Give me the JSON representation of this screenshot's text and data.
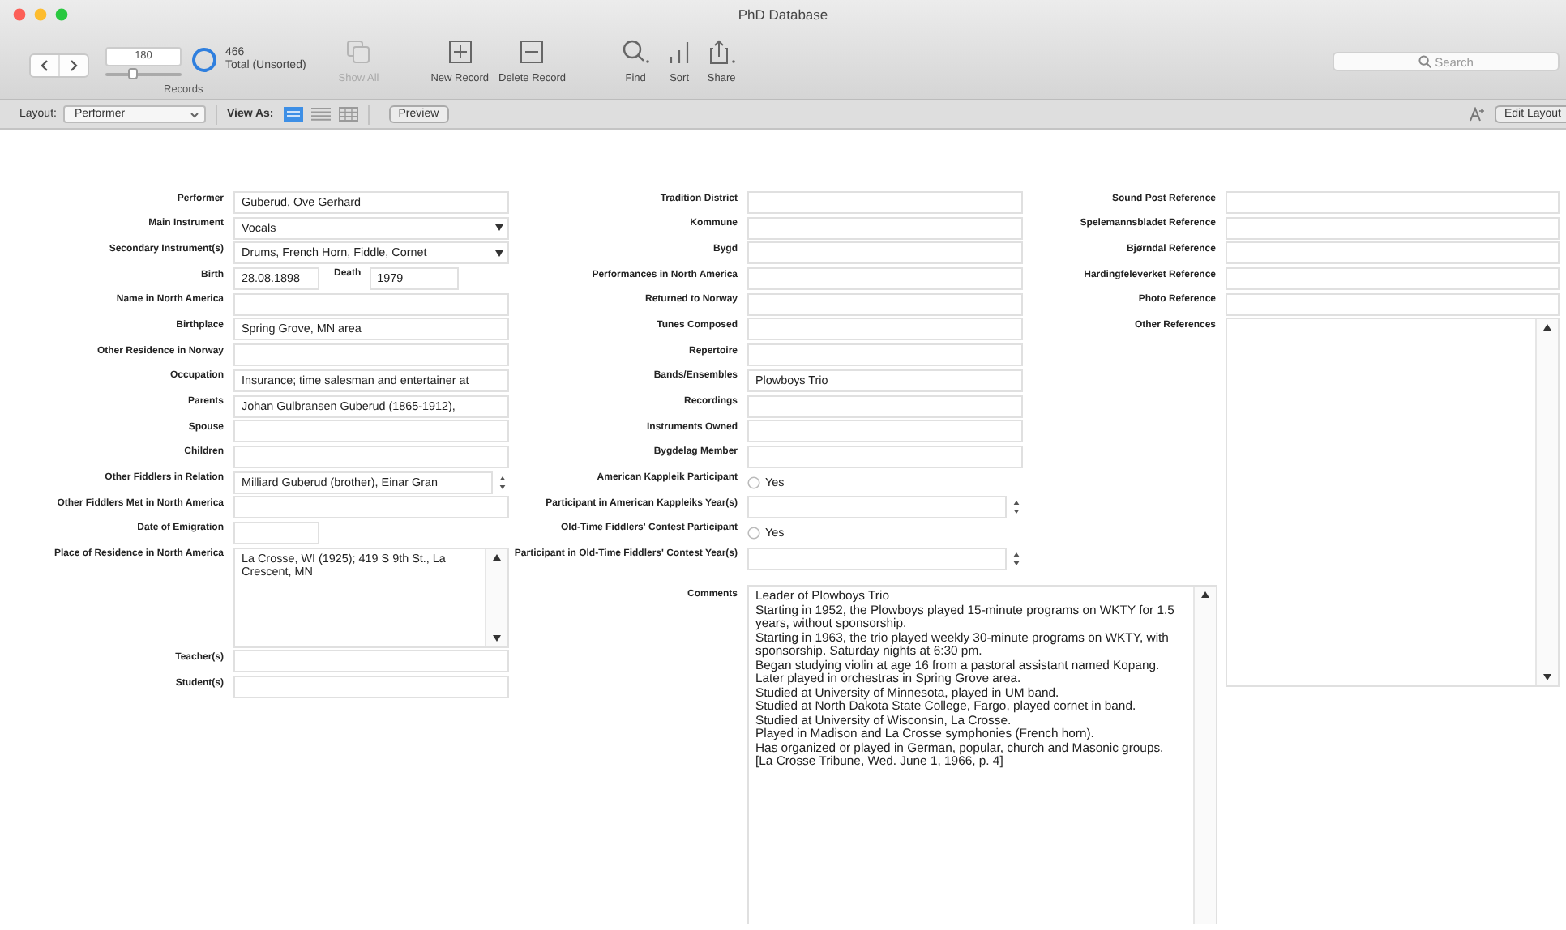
{
  "window": {
    "title": "PhD Database"
  },
  "toolbar": {
    "records": {
      "current": "180",
      "level": 0.39,
      "count": "466",
      "sort_status": "Total (Unsorted)",
      "label": "Records"
    },
    "buttons": [
      {
        "kind": "show-all",
        "label": "Show All",
        "disabled": true
      },
      {
        "kind": "new",
        "label": "New Record",
        "disabled": false
      },
      {
        "kind": "delete",
        "label": "Delete Record",
        "disabled": false
      },
      {
        "kind": "find",
        "label": "Find",
        "disabled": false
      },
      {
        "kind": "sort",
        "label": "Sort",
        "disabled": false
      },
      {
        "kind": "share",
        "label": "Share",
        "disabled": false
      }
    ],
    "search": {
      "placeholder": "Search"
    }
  },
  "layout_bar": {
    "layout_label": "Layout:",
    "layout": "Performer",
    "view_as_label": "View As:",
    "views": [
      {
        "kind": "form",
        "selected": true
      },
      {
        "kind": "list",
        "selected": false
      },
      {
        "kind": "table",
        "selected": false
      }
    ],
    "preview": "Preview",
    "edit_layout": "Edit Layout"
  },
  "form": {
    "columns": [
      {
        "fields": [
          {
            "kind": "text",
            "label": "Performer",
            "value": "Guberud, Ove Gerhard"
          },
          {
            "kind": "dropdown",
            "label": "Main Instrument",
            "value": "Vocals"
          },
          {
            "kind": "dropdown",
            "label": "Secondary Instrument(s)",
            "value": "Drums, French Horn, Fiddle, Cornet"
          },
          {
            "kind": "pair",
            "label": "Birth",
            "value": "28.08.1898",
            "second_label": "Death",
            "second_value": "1979"
          },
          {
            "kind": "text",
            "label": "Name in North America"
          },
          {
            "kind": "text",
            "label": "Birthplace",
            "value": "Spring Grove, MN area"
          },
          {
            "kind": "text",
            "label": "Other Residence in Norway"
          },
          {
            "kind": "text",
            "label": "Occupation",
            "value": "Insurance; time salesman and entertainer at"
          },
          {
            "kind": "text",
            "label": "Parents",
            "value": "Johan Gulbransen Guberud (1865-1912),"
          },
          {
            "kind": "text",
            "label": "Spouse"
          },
          {
            "kind": "text",
            "label": "Children"
          },
          {
            "kind": "stepper",
            "label": "Other Fiddlers in Relation",
            "value": "Milliard Guberud (brother), Einar Gran"
          },
          {
            "kind": "text",
            "label": "Other Fiddlers Met in North America"
          },
          {
            "kind": "short",
            "label": "Date of Emigration"
          },
          {
            "kind": "textarea",
            "label": "Place of Residence in North America",
            "lines": [
              "La Crosse, WI (1925); 419 S 9th St., La Crescent, MN"
            ]
          },
          {
            "kind": "text",
            "label": "Teacher(s)"
          },
          {
            "kind": "text",
            "label": "Student(s)"
          }
        ]
      },
      {
        "fields": [
          {
            "kind": "text",
            "label": "Tradition District"
          },
          {
            "kind": "text",
            "label": "Kommune"
          },
          {
            "kind": "text",
            "label": "Bygd"
          },
          {
            "kind": "text",
            "label": "Performances in North America"
          },
          {
            "kind": "text",
            "label": "Returned to Norway"
          },
          {
            "kind": "text",
            "label": "Tunes Composed"
          },
          {
            "kind": "text",
            "label": "Repertoire"
          },
          {
            "kind": "text",
            "label": "Bands/Ensembles",
            "value": "Plowboys Trio"
          },
          {
            "kind": "text",
            "label": "Recordings"
          },
          {
            "kind": "text",
            "label": "Instruments Owned"
          },
          {
            "kind": "text",
            "label": "Bygdelag Member"
          },
          {
            "kind": "radio",
            "label": "American Kappleik Participant",
            "value": "Yes",
            "checked": false
          },
          {
            "kind": "stepper",
            "label": "Participant in American Kappleiks Year(s)"
          },
          {
            "kind": "radio",
            "label": "Old-Time Fiddlers' Contest Participant",
            "value": "Yes",
            "checked": false
          },
          {
            "kind": "stepper",
            "label": "Participant in Old-Time Fiddlers' Contest Year(s)"
          },
          {
            "kind": "notes",
            "label": "Comments",
            "lines": [
              "Leader of Plowboys Trio",
              "Starting in 1952, the Plowboys played 15-minute programs on WKTY for 1.5 years, without sponsorship.",
              "Starting in 1963, the trio played weekly 30-minute programs on WKTY, with sponsorship. Saturday nights at 6:30 pm.",
              "Began studying violin at age 16 from a pastoral assistant named Kopang.",
              "Later played in orchestras in Spring Grove area.",
              "Studied at University of Minnesota, played in UM band.",
              "Studied at North Dakota State College, Fargo, played cornet in band.",
              "Studied at University of Wisconsin, La Crosse.",
              "Played in Madison and La Crosse symphonies (French horn).",
              "Has organized or played in German, popular, church and Masonic groups.",
              "[La Crosse Tribune, Wed. June 1, 1966, p. 4]"
            ]
          }
        ]
      },
      {
        "fields": [
          {
            "kind": "text",
            "label": "Sound Post Reference"
          },
          {
            "kind": "text",
            "label": "Spelemannsbladet Reference"
          },
          {
            "kind": "text",
            "label": "Bjørndal Reference"
          },
          {
            "kind": "text",
            "label": "Hardingfeleverket Reference"
          },
          {
            "kind": "text",
            "label": "Photo Reference"
          },
          {
            "kind": "references",
            "label": "Other References"
          }
        ]
      }
    ]
  }
}
